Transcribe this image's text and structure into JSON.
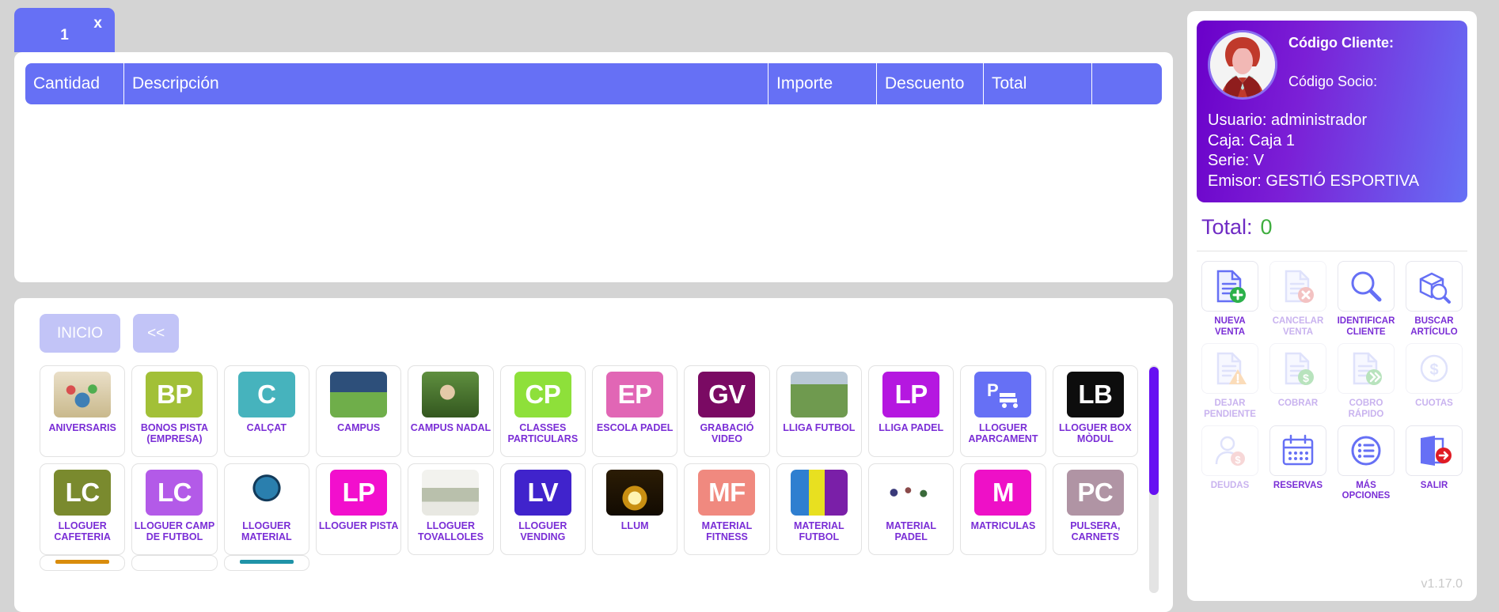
{
  "tab": {
    "label": "1",
    "close": "x"
  },
  "ticket": {
    "columns": [
      {
        "key": "cantidad",
        "label": "Cantidad"
      },
      {
        "key": "descripcion",
        "label": "Descripción"
      },
      {
        "key": "importe",
        "label": "Importe"
      },
      {
        "key": "descuento",
        "label": "Descuento"
      },
      {
        "key": "total",
        "label": "Total"
      },
      {
        "key": "actions",
        "label": ""
      }
    ],
    "rows": []
  },
  "nav": {
    "home": "INICIO",
    "back": "<<"
  },
  "products": [
    {
      "label": "ANIVERSARIS",
      "initials": "",
      "color": "#b9a35a",
      "icon": "birthday-cake-photo"
    },
    {
      "label": "BONOS PISTA (EMPRESA)",
      "initials": "BP",
      "color": "#a2c037"
    },
    {
      "label": "CALÇAT",
      "initials": "C",
      "color": "#46b3bd"
    },
    {
      "label": "CAMPUS",
      "initials": "",
      "color": "#3f6f3f",
      "icon": "campus-photo"
    },
    {
      "label": "CAMPUS NADAL",
      "initials": "",
      "color": "#6b8f4e",
      "icon": "child-ball-photo"
    },
    {
      "label": "CLASSES PARTICULARS",
      "initials": "CP",
      "color": "#8ee03a"
    },
    {
      "label": "ESCOLA PADEL",
      "initials": "EP",
      "color": "#e166b5"
    },
    {
      "label": "GRABACIÓ VIDEO",
      "initials": "GV",
      "color": "#7a0a63"
    },
    {
      "label": "LLIGA FUTBOL",
      "initials": "",
      "color": "#6c8f5a",
      "icon": "football-field-photo"
    },
    {
      "label": "LLIGA PADEL",
      "initials": "LP",
      "color": "#b517e0"
    },
    {
      "label": "LLOGUER APARCAMENT",
      "initials": "",
      "color": "#6670f5",
      "icon": "parking-icon"
    },
    {
      "label": "LLOGUER BOX MÒDUL",
      "initials": "LB",
      "color": "#0d0d0d"
    },
    {
      "label": "LLOGUER CAFETERIA",
      "initials": "LC",
      "color": "#7a8a2e"
    },
    {
      "label": "LLOGUER CAMP DE FUTBOL",
      "initials": "LC",
      "color": "#b35ae8"
    },
    {
      "label": "LLOGUER MATERIAL",
      "initials": "",
      "color": "#2b4f7a",
      "icon": "padel-racket-photo"
    },
    {
      "label": "LLOGUER PISTA",
      "initials": "LP",
      "color": "#f20fcd"
    },
    {
      "label": "LLOGUER TOVALLOLES",
      "initials": "",
      "color": "#cfd3cc",
      "icon": "towels-photo"
    },
    {
      "label": "LLOGUER VENDING",
      "initials": "LV",
      "color": "#4023cc"
    },
    {
      "label": "LLUM",
      "initials": "",
      "color": "#3a2608",
      "icon": "lightbulb-photo"
    },
    {
      "label": "MATERIAL FITNESS",
      "initials": "MF",
      "color": "#f0897f"
    },
    {
      "label": "MATERIAL FUTBOL",
      "initials": "",
      "color": "#2b6fc9",
      "icon": "jerseys-photo"
    },
    {
      "label": "MATERIAL PADEL",
      "initials": "",
      "color": "#ffffff",
      "icon": "people-photo"
    },
    {
      "label": "MATRICULAS",
      "initials": "M",
      "color": "#ee10c7"
    },
    {
      "label": "PULSERA, CARNETS",
      "initials": "PC",
      "color": "#b094a4"
    }
  ],
  "products_partial": [
    {
      "color": "#d98c0c"
    },
    {
      "color": "#ffffff"
    },
    {
      "color": "#1f93a8"
    }
  ],
  "user": {
    "codigo_cliente": "Código Cliente:",
    "codigo_socio": "Código Socio:",
    "usuario": "Usuario: administrador",
    "caja": "Caja: Caja 1",
    "serie": "Serie: V",
    "emisor": "Emisor: GESTIÓ ESPORTIVA"
  },
  "total": {
    "label": "Total:",
    "value": "0"
  },
  "actions": [
    {
      "label": "NUEVA VENTA",
      "icon": "document-add-icon",
      "enabled": true
    },
    {
      "label": "CANCELAR VENTA",
      "icon": "document-cancel-icon",
      "enabled": false
    },
    {
      "label": "IDENTIFICAR CLIENTE",
      "icon": "magnifier-icon",
      "enabled": true
    },
    {
      "label": "BUSCAR ARTÍCULO",
      "icon": "box-search-icon",
      "enabled": true
    },
    {
      "label": "DEJAR PENDIENTE",
      "icon": "document-warning-icon",
      "enabled": false
    },
    {
      "label": "COBRAR",
      "icon": "document-money-icon",
      "enabled": false
    },
    {
      "label": "COBRO RÁPIDO",
      "icon": "document-fast-icon",
      "enabled": false
    },
    {
      "label": "CUOTAS",
      "icon": "dollar-circle-icon",
      "enabled": false
    },
    {
      "label": "DEUDAS",
      "icon": "person-money-icon",
      "enabled": false
    },
    {
      "label": "RESERVAS",
      "icon": "calendar-icon",
      "enabled": true
    },
    {
      "label": "MÁS OPCIONES",
      "icon": "list-circle-icon",
      "enabled": true
    },
    {
      "label": "SALIR",
      "icon": "exit-door-icon",
      "enabled": true
    }
  ],
  "version": "v1.17.0",
  "colors": {
    "accent_blue": "#6670f5",
    "accent_purple": "#7a2ed6",
    "total_green": "#3fae3f",
    "page_bg": "#d4d4d4"
  }
}
